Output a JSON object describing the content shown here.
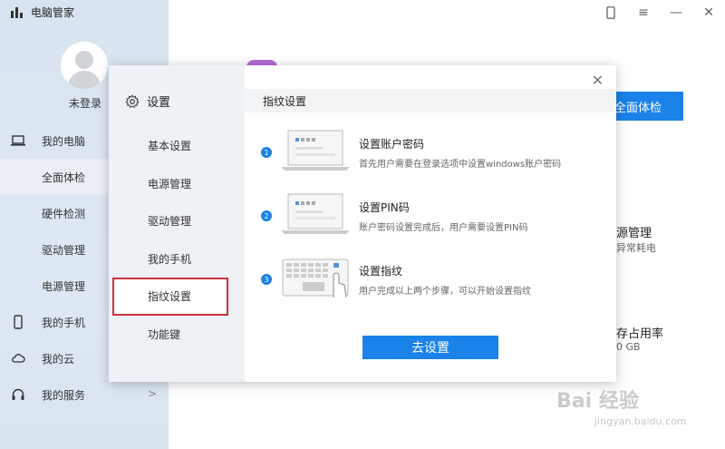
{
  "app": {
    "title": "电脑管家"
  },
  "user": {
    "login_label": "未登录"
  },
  "sidebar": {
    "items": [
      {
        "label": "我的电脑",
        "icon": "laptop-icon",
        "group": true
      },
      {
        "label": "全面体检",
        "active": true
      },
      {
        "label": "硬件检测"
      },
      {
        "label": "驱动管理"
      },
      {
        "label": "电源管理"
      },
      {
        "label": "我的手机",
        "icon": "phone-icon",
        "group": true
      },
      {
        "label": "我的云",
        "icon": "cloud-icon",
        "group": true
      },
      {
        "label": "我的服务",
        "icon": "headset-icon",
        "group": true
      }
    ]
  },
  "background": {
    "scan_button": "全面体检",
    "card1_title": "源管理",
    "card1_sub": "异常耗电",
    "card2_title": "存占用率",
    "card2_sub": "0 GB"
  },
  "dialog": {
    "settings_title": "设置",
    "menu": [
      "基本设置",
      "电源管理",
      "驱动管理",
      "我的手机",
      "指纹设置",
      "功能键"
    ],
    "selected_index": 4,
    "section_title": "指纹设置",
    "steps": [
      {
        "num": "1",
        "title": "设置账户密码",
        "desc": "首先用户需要在登录选项中设置windows账户密码"
      },
      {
        "num": "2",
        "title": "设置PIN码",
        "desc": "账户密码设置完成后，用户需要设置PIN码"
      },
      {
        "num": "3",
        "title": "设置指纹",
        "desc": "用户完成以上两个步骤，可以开始设置指纹"
      }
    ],
    "go_button": "去设置"
  },
  "watermark": {
    "text": "Bai 经验",
    "sub": "jingyan.baidu.com"
  },
  "colors": {
    "accent": "#1a82e8",
    "highlight": "#c8343a"
  }
}
